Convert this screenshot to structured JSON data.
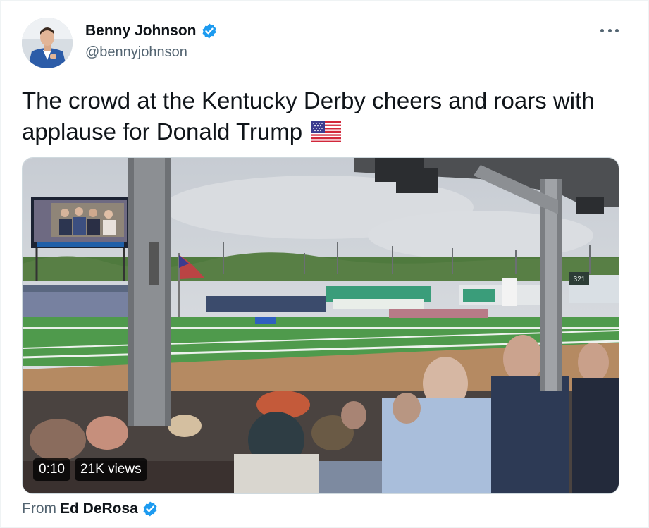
{
  "author": {
    "display_name": "Benny Johnson",
    "handle": "@bennyjohnson",
    "verified_icon": "verified-badge-icon"
  },
  "tweet": {
    "text": "The crowd at the Kentucky Derby cheers and roars with applause for Donald Trump",
    "emoji": "us-flag-icon"
  },
  "video": {
    "duration": "0:10",
    "views": "21K views",
    "scoreboard_number": "321"
  },
  "attribution": {
    "label": "From",
    "source_name": "Ed DeRosa"
  },
  "colors": {
    "verified_blue": "#1d9bf0",
    "secondary_text": "#536471",
    "primary_text": "#0f1419"
  }
}
